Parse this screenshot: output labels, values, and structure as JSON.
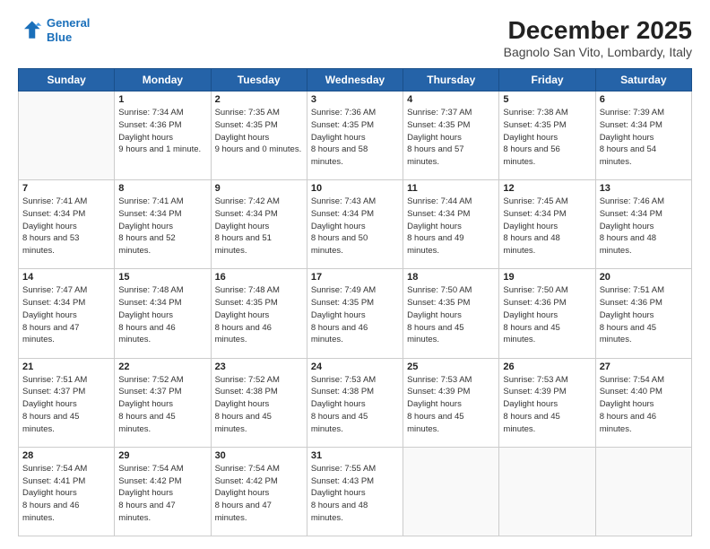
{
  "header": {
    "logo_line1": "General",
    "logo_line2": "Blue",
    "month_title": "December 2025",
    "subtitle": "Bagnolo San Vito, Lombardy, Italy"
  },
  "weekdays": [
    "Sunday",
    "Monday",
    "Tuesday",
    "Wednesday",
    "Thursday",
    "Friday",
    "Saturday"
  ],
  "weeks": [
    [
      {
        "day": "",
        "empty": true
      },
      {
        "day": "1",
        "sunrise": "7:34 AM",
        "sunset": "4:36 PM",
        "daylight": "9 hours and 1 minute."
      },
      {
        "day": "2",
        "sunrise": "7:35 AM",
        "sunset": "4:35 PM",
        "daylight": "9 hours and 0 minutes."
      },
      {
        "day": "3",
        "sunrise": "7:36 AM",
        "sunset": "4:35 PM",
        "daylight": "8 hours and 58 minutes."
      },
      {
        "day": "4",
        "sunrise": "7:37 AM",
        "sunset": "4:35 PM",
        "daylight": "8 hours and 57 minutes."
      },
      {
        "day": "5",
        "sunrise": "7:38 AM",
        "sunset": "4:35 PM",
        "daylight": "8 hours and 56 minutes."
      },
      {
        "day": "6",
        "sunrise": "7:39 AM",
        "sunset": "4:34 PM",
        "daylight": "8 hours and 54 minutes."
      }
    ],
    [
      {
        "day": "7",
        "sunrise": "7:41 AM",
        "sunset": "4:34 PM",
        "daylight": "8 hours and 53 minutes."
      },
      {
        "day": "8",
        "sunrise": "7:41 AM",
        "sunset": "4:34 PM",
        "daylight": "8 hours and 52 minutes."
      },
      {
        "day": "9",
        "sunrise": "7:42 AM",
        "sunset": "4:34 PM",
        "daylight": "8 hours and 51 minutes."
      },
      {
        "day": "10",
        "sunrise": "7:43 AM",
        "sunset": "4:34 PM",
        "daylight": "8 hours and 50 minutes."
      },
      {
        "day": "11",
        "sunrise": "7:44 AM",
        "sunset": "4:34 PM",
        "daylight": "8 hours and 49 minutes."
      },
      {
        "day": "12",
        "sunrise": "7:45 AM",
        "sunset": "4:34 PM",
        "daylight": "8 hours and 48 minutes."
      },
      {
        "day": "13",
        "sunrise": "7:46 AM",
        "sunset": "4:34 PM",
        "daylight": "8 hours and 48 minutes."
      }
    ],
    [
      {
        "day": "14",
        "sunrise": "7:47 AM",
        "sunset": "4:34 PM",
        "daylight": "8 hours and 47 minutes."
      },
      {
        "day": "15",
        "sunrise": "7:48 AM",
        "sunset": "4:34 PM",
        "daylight": "8 hours and 46 minutes."
      },
      {
        "day": "16",
        "sunrise": "7:48 AM",
        "sunset": "4:35 PM",
        "daylight": "8 hours and 46 minutes."
      },
      {
        "day": "17",
        "sunrise": "7:49 AM",
        "sunset": "4:35 PM",
        "daylight": "8 hours and 46 minutes."
      },
      {
        "day": "18",
        "sunrise": "7:50 AM",
        "sunset": "4:35 PM",
        "daylight": "8 hours and 45 minutes."
      },
      {
        "day": "19",
        "sunrise": "7:50 AM",
        "sunset": "4:36 PM",
        "daylight": "8 hours and 45 minutes."
      },
      {
        "day": "20",
        "sunrise": "7:51 AM",
        "sunset": "4:36 PM",
        "daylight": "8 hours and 45 minutes."
      }
    ],
    [
      {
        "day": "21",
        "sunrise": "7:51 AM",
        "sunset": "4:37 PM",
        "daylight": "8 hours and 45 minutes."
      },
      {
        "day": "22",
        "sunrise": "7:52 AM",
        "sunset": "4:37 PM",
        "daylight": "8 hours and 45 minutes."
      },
      {
        "day": "23",
        "sunrise": "7:52 AM",
        "sunset": "4:38 PM",
        "daylight": "8 hours and 45 minutes."
      },
      {
        "day": "24",
        "sunrise": "7:53 AM",
        "sunset": "4:38 PM",
        "daylight": "8 hours and 45 minutes."
      },
      {
        "day": "25",
        "sunrise": "7:53 AM",
        "sunset": "4:39 PM",
        "daylight": "8 hours and 45 minutes."
      },
      {
        "day": "26",
        "sunrise": "7:53 AM",
        "sunset": "4:39 PM",
        "daylight": "8 hours and 45 minutes."
      },
      {
        "day": "27",
        "sunrise": "7:54 AM",
        "sunset": "4:40 PM",
        "daylight": "8 hours and 46 minutes."
      }
    ],
    [
      {
        "day": "28",
        "sunrise": "7:54 AM",
        "sunset": "4:41 PM",
        "daylight": "8 hours and 46 minutes."
      },
      {
        "day": "29",
        "sunrise": "7:54 AM",
        "sunset": "4:42 PM",
        "daylight": "8 hours and 47 minutes."
      },
      {
        "day": "30",
        "sunrise": "7:54 AM",
        "sunset": "4:42 PM",
        "daylight": "8 hours and 47 minutes."
      },
      {
        "day": "31",
        "sunrise": "7:55 AM",
        "sunset": "4:43 PM",
        "daylight": "8 hours and 48 minutes."
      },
      {
        "day": "",
        "empty": true
      },
      {
        "day": "",
        "empty": true
      },
      {
        "day": "",
        "empty": true
      }
    ]
  ]
}
